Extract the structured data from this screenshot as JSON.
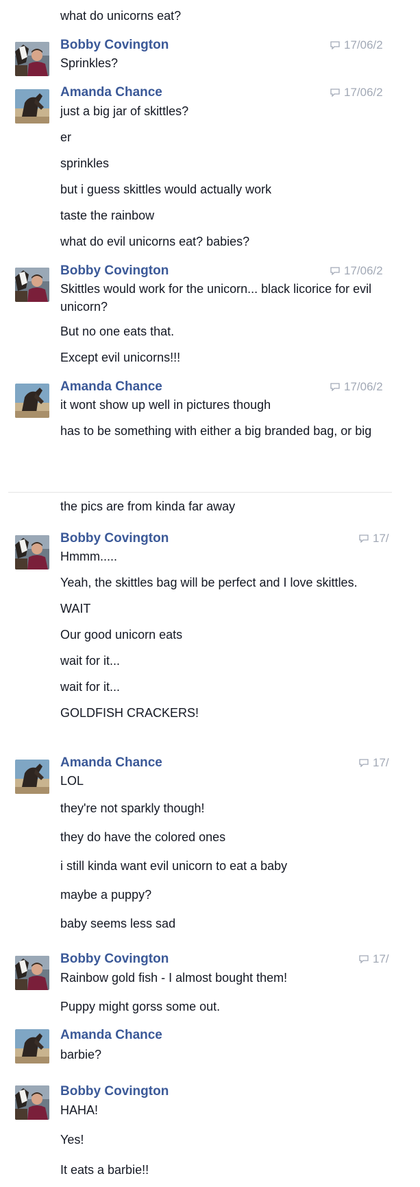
{
  "thread": {
    "orphan_message": "what do unicorns eat?",
    "groups": [
      {
        "sender": "Bobby Covington",
        "timestamp": "17/06/2",
        "messages": [
          "Sprinkles?"
        ]
      },
      {
        "sender": "Amanda Chance",
        "timestamp": "17/06/2",
        "messages": [
          "just a big jar of skittles?",
          "er",
          "sprinkles",
          "but i guess skittles would actually work",
          "taste the rainbow",
          "what do evil unicorns eat? babies?"
        ]
      },
      {
        "sender": "Bobby Covington",
        "timestamp": "17/06/2",
        "messages": [
          "Skittles would work for the unicorn... black licorice for evil unicorn?",
          "But no one eats that.",
          "Except evil unicorns!!!"
        ]
      },
      {
        "sender": "Amanda Chance",
        "timestamp": "17/06/2",
        "messages": [
          "it wont show up well in pictures though",
          "has to be something with either a big branded bag, or big",
          "the pics are from kinda far away"
        ]
      },
      {
        "sender": "Bobby Covington",
        "timestamp": "17/",
        "messages": [
          "Hmmm.....",
          "Yeah, the skittles bag will be perfect and I love skittles.",
          "WAIT",
          "Our good unicorn eats",
          "wait for it...",
          "wait for it...",
          "GOLDFISH CRACKERS!"
        ]
      },
      {
        "sender": "Amanda Chance",
        "timestamp": "17/",
        "messages": [
          "LOL",
          "they're not sparkly though!",
          "they do have the colored ones",
          "i still kinda want evil unicorn to eat a baby",
          "maybe a puppy?",
          "baby seems less sad"
        ]
      },
      {
        "sender": "Bobby Covington",
        "timestamp": "17/",
        "messages": [
          "Rainbow gold fish - I almost bought them!",
          "Puppy might gorss some out."
        ]
      },
      {
        "sender": "Amanda Chance",
        "timestamp": "",
        "messages": [
          "barbie?"
        ]
      },
      {
        "sender": "Bobby Covington",
        "timestamp": "",
        "messages": [
          "HAHA!",
          "Yes!",
          "It eats a barbie!!"
        ]
      }
    ]
  },
  "icons": {
    "timestamp": "chat-bubble-icon",
    "bobby_avatar": "person-with-horse-avatar",
    "amanda_avatar": "horse-on-beach-avatar"
  },
  "colors": {
    "sender_name": "#3b5998",
    "message_text": "#141823",
    "timestamp": "#a2a9b6",
    "divider": "#e5e5e5"
  }
}
